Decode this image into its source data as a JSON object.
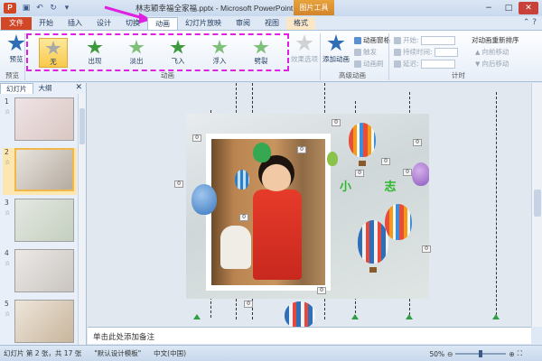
{
  "window": {
    "title": "林志颖幸福全家福.pptx - Microsoft PowerPoint",
    "tool_tab_header": "图片工具",
    "controls": [
      "−",
      "□",
      "✕"
    ],
    "app_icon": "P"
  },
  "tabs": [
    {
      "label": "文件"
    },
    {
      "label": "开始"
    },
    {
      "label": "插入"
    },
    {
      "label": "设计"
    },
    {
      "label": "切换"
    },
    {
      "label": "动画"
    },
    {
      "label": "幻灯片放映"
    },
    {
      "label": "审阅"
    },
    {
      "label": "视图"
    },
    {
      "label": "格式"
    }
  ],
  "ribbon": {
    "preview_label": "预览",
    "preview_group": "预览",
    "animation_group": "动画",
    "advanced_group": "高级动画",
    "timing_group": "计时",
    "gallery": [
      {
        "label": "无"
      },
      {
        "label": "出现"
      },
      {
        "label": "淡出"
      },
      {
        "label": "飞入"
      },
      {
        "label": "浮入"
      },
      {
        "label": "劈裂"
      }
    ],
    "effect_options": "效果选项",
    "add_animation": "添加动画",
    "animation_pane": "动画窗格",
    "trigger": "触发",
    "animation_painter": "动画刷",
    "start_label": "开始:",
    "duration_label": "持续时间:",
    "delay_label": "延迟:",
    "reorder_label": "对动画重新排序",
    "move_earlier": "向前移动",
    "move_later": "向后移动"
  },
  "left_panel": {
    "tab_slides": "幻灯片",
    "tab_outline": "大纲",
    "close": "✕",
    "slides": [
      {
        "num": "1",
        "star": "☆"
      },
      {
        "num": "2",
        "star": "☆"
      },
      {
        "num": "3",
        "star": "☆"
      },
      {
        "num": "4",
        "star": "☆"
      },
      {
        "num": "5",
        "star": "☆"
      }
    ]
  },
  "slide": {
    "text": "小 志",
    "anim_tags": [
      "0",
      "0",
      "0",
      "0",
      "0",
      "0",
      "0",
      "0",
      "0",
      "0",
      "0",
      "0"
    ]
  },
  "notes": {
    "placeholder": "单击此处添加备注"
  },
  "status": {
    "slide_info": "幻灯片 第 2 张，共 17 张",
    "theme": "\"默认设计模板\"",
    "language": "中文(中国)",
    "zoom": "50%"
  },
  "colors": {
    "file_tab": "#d24726",
    "highlight_box": "#e020e0",
    "selected_item": "#f8c94c"
  }
}
